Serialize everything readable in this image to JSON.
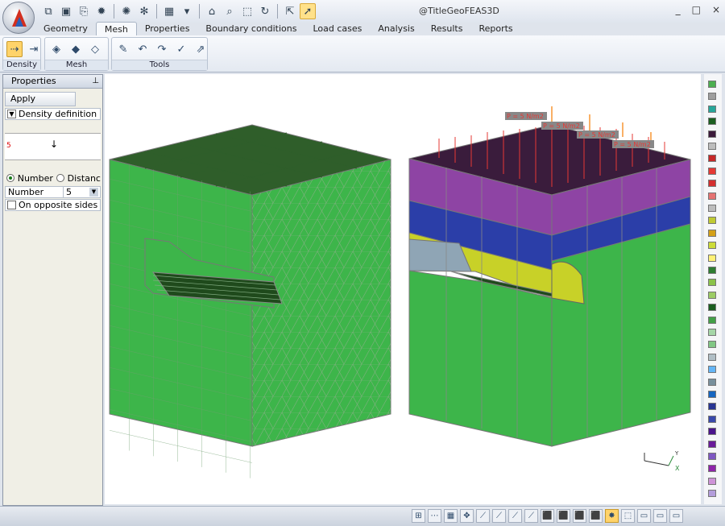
{
  "window": {
    "title": "@TitleGeoFEAS3D",
    "controls": [
      "_",
      "□",
      "×"
    ]
  },
  "quick_access": [
    "⧉",
    "▣",
    "⎘",
    "✹",
    "✺",
    "✻",
    "▦",
    "▾",
    "⌂",
    "⌕",
    "⬚",
    "↻",
    "⇱",
    "➚"
  ],
  "tabs": [
    "Geometry",
    "Mesh",
    "Properties",
    "Boundary conditions",
    "Load cases",
    "Analysis",
    "Results",
    "Reports"
  ],
  "active_tab": "Mesh",
  "ribbon": {
    "groups": [
      {
        "label": "Density",
        "icons": [
          "⇢",
          "⇥"
        ]
      },
      {
        "label": "Mesh",
        "icons": [
          "◈",
          "◆",
          "◇"
        ]
      },
      {
        "label": "Tools",
        "icons": [
          "✎",
          "↶",
          "↷",
          "✓",
          "⇗"
        ]
      }
    ]
  },
  "properties_panel": {
    "title": "Properties",
    "pin": "⊥",
    "apply": "Apply",
    "section": "Density definition",
    "preview_value": "5",
    "radio_number": "Number",
    "radio_distance": "Distanc",
    "field_label": "Number",
    "field_value": "5",
    "checkbox_label": "On opposite sides"
  },
  "viewport": {
    "load_labels": [
      "P = 5 N/m2",
      "P = 5 N/m2",
      "P = 5 N/m2",
      "P = 5 N/m2"
    ],
    "axis_labels": {
      "x": "X",
      "y": "Y"
    }
  },
  "palette_colors": [
    "#4caf50",
    "#9e9e9e",
    "#26a69a",
    "#1b5e20",
    "#3b1a3b",
    "#bdbdbd",
    "#c62828",
    "#e53935",
    "#d32f2f",
    "#e57373",
    "#bdbdbd",
    "#c0ca33",
    "#d4a017",
    "#cddc39",
    "#fff176",
    "#2e7d32",
    "#8bc34a",
    "#9ccc65",
    "#1b5e20",
    "#43a047",
    "#a5d6a7",
    "#81c784",
    "#b0bec5",
    "#64b5f6",
    "#78909c",
    "#1565c0",
    "#283593",
    "#3949ab",
    "#4a148c",
    "#6a1b9a",
    "#7e57c2",
    "#8e24aa",
    "#ce93d8",
    "#b39ddb"
  ],
  "status_icons": [
    "⊞",
    "⋯",
    "▦",
    "✥",
    "⟋",
    "⟋",
    "⟋",
    "⟋",
    "⬛",
    "⬛",
    "⬛",
    "⬛",
    "✸",
    "⬚",
    "▭",
    "▭",
    "▭"
  ]
}
